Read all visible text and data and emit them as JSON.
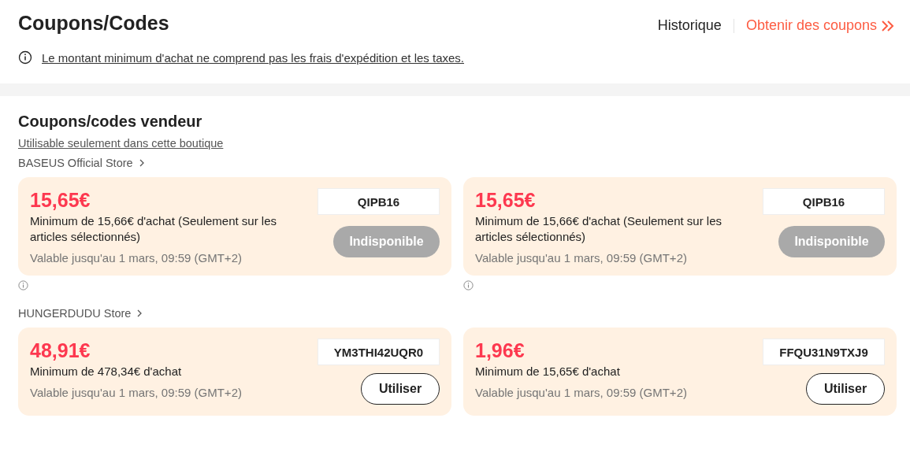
{
  "header": {
    "title": "Coupons/Codes",
    "links": [
      {
        "label": "Historique",
        "kind": "plain"
      },
      {
        "label": "Obtenir des coupons",
        "kind": "accent"
      }
    ],
    "notice": "Le montant minimum d'achat ne comprend pas les frais d'expédition et les taxes."
  },
  "section": {
    "title": "Coupons/codes vendeur",
    "subtitle": "Utilisable seulement dans cette boutique",
    "stores": [
      {
        "name": "BASEUS Official Store",
        "coupons": [
          {
            "amount": "15,65€",
            "condition": "Minimum de 15,66€ d'achat (Seulement sur les articles sélectionnés)",
            "validity": "Valable jusqu'au 1 mars, 09:59 (GMT+2)",
            "code": "QIPB16",
            "button": "Indisponible",
            "disabled": true,
            "info": true
          },
          {
            "amount": "15,65€",
            "condition": "Minimum de 15,66€ d'achat (Seulement sur les articles sélectionnés)",
            "validity": "Valable jusqu'au 1 mars, 09:59 (GMT+2)",
            "code": "QIPB16",
            "button": "Indisponible",
            "disabled": true,
            "info": true
          }
        ]
      },
      {
        "name": "HUNGERDUDU Store",
        "coupons": [
          {
            "amount": "48,91€",
            "condition": "Minimum de 478,34€ d'achat",
            "validity": "Valable jusqu'au 1 mars, 09:59 (GMT+2)",
            "code": "YM3THI42UQR0",
            "button": "Utiliser",
            "disabled": false,
            "info": false
          },
          {
            "amount": "1,96€",
            "condition": "Minimum de 15,65€ d'achat",
            "validity": "Valable jusqu'au 1 mars, 09:59 (GMT+2)",
            "code": "FFQU31N9TXJ9",
            "button": "Utiliser",
            "disabled": false,
            "info": false
          }
        ]
      }
    ]
  }
}
